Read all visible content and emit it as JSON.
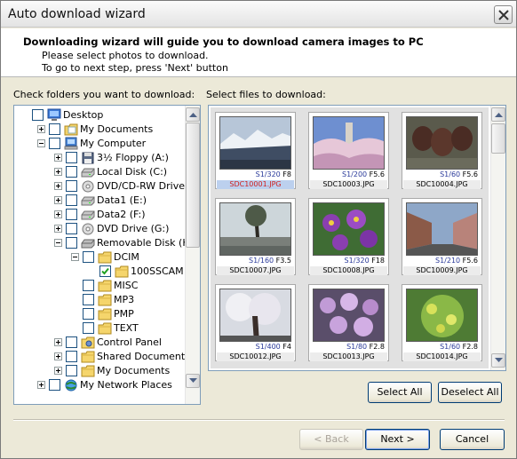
{
  "window": {
    "title": "Auto download wizard",
    "close_icon": "close-icon"
  },
  "header": {
    "title": "Downloading wizard will guide you to download camera images to PC",
    "line1": "Please select photos to download.",
    "line2": "To go to next step, press 'Next' button"
  },
  "folders": {
    "label": "Check folders you want to download:",
    "items": [
      {
        "label": "Desktop",
        "icon": "desktop-icon",
        "expander": "none",
        "checked": false
      },
      {
        "label": "My Documents",
        "icon": "folder-docs-icon",
        "expander": "plus",
        "checked": false
      },
      {
        "label": "My Computer",
        "icon": "computer-icon",
        "expander": "minus",
        "checked": false
      },
      {
        "label": "3½ Floppy (A:)",
        "icon": "floppy-icon",
        "expander": "plus",
        "checked": false
      },
      {
        "label": "Local Disk (C:)",
        "icon": "hard-disk-icon",
        "expander": "plus",
        "checked": false
      },
      {
        "label": "DVD/CD-RW Drive (D:)",
        "icon": "cd-drive-icon",
        "expander": "plus",
        "checked": false
      },
      {
        "label": "Data1 (E:)",
        "icon": "hard-disk-icon",
        "expander": "plus",
        "checked": false
      },
      {
        "label": "Data2 (F:)",
        "icon": "hard-disk-icon",
        "expander": "plus",
        "checked": false
      },
      {
        "label": "DVD Drive (G:)",
        "icon": "cd-drive-icon",
        "expander": "plus",
        "checked": false
      },
      {
        "label": "Removable Disk (K:)",
        "icon": "removable-disk-icon",
        "expander": "minus",
        "checked": false
      },
      {
        "label": "DCIM",
        "icon": "folder-icon",
        "expander": "minus",
        "checked": false
      },
      {
        "label": "100SSCAM",
        "icon": "folder-icon",
        "expander": "none",
        "checked": true
      },
      {
        "label": "MISC",
        "icon": "folder-icon",
        "expander": "none",
        "checked": false
      },
      {
        "label": "MP3",
        "icon": "folder-icon",
        "expander": "none",
        "checked": false
      },
      {
        "label": "PMP",
        "icon": "folder-icon",
        "expander": "none",
        "checked": false
      },
      {
        "label": "TEXT",
        "icon": "folder-icon",
        "expander": "none",
        "checked": false
      },
      {
        "label": "Control Panel",
        "icon": "control-panel-icon",
        "expander": "plus",
        "checked": false
      },
      {
        "label": "Shared Documents",
        "icon": "folder-icon",
        "expander": "plus",
        "checked": false
      },
      {
        "label": "My Documents",
        "icon": "folder-icon",
        "expander": "plus",
        "checked": false
      },
      {
        "label": "My Network Places",
        "icon": "network-icon",
        "expander": "plus",
        "checked": false
      }
    ]
  },
  "files": {
    "label": "Select files to download:",
    "thumbnails": [
      {
        "name": "SDC10001.JPG",
        "shutter": "S1/320",
        "aperture": "F8",
        "selected": true,
        "scene": "snowy-mountain-lake"
      },
      {
        "name": "SDC10003.JPG",
        "shutter": "S1/200",
        "aperture": "F5.6",
        "selected": false,
        "scene": "cherry-blossom-tower"
      },
      {
        "name": "SDC10004.JPG",
        "shutter": "S1/60",
        "aperture": "F5.6",
        "selected": false,
        "scene": "clay-pots"
      },
      {
        "name": "SDC10007.JPG",
        "shutter": "S1/160",
        "aperture": "F3.5",
        "selected": false,
        "scene": "tree-in-water"
      },
      {
        "name": "SDC10008.JPG",
        "shutter": "S1/320",
        "aperture": "F18",
        "selected": false,
        "scene": "purple-flowers"
      },
      {
        "name": "SDC10009.JPG",
        "shutter": "S1/210",
        "aperture": "F5.6",
        "selected": false,
        "scene": "city-street"
      },
      {
        "name": "SDC10012.JPG",
        "shutter": "S1/400",
        "aperture": "F4",
        "selected": false,
        "scene": "blossom-tree"
      },
      {
        "name": "SDC10013.JPG",
        "shutter": "S1/80",
        "aperture": "F2.8",
        "selected": false,
        "scene": "flower-bush"
      },
      {
        "name": "SDC10014.JPG",
        "shutter": "S1/60",
        "aperture": "F2.8",
        "selected": false,
        "scene": "green-shrub"
      }
    ]
  },
  "buttons": {
    "select_all": "Select All",
    "deselect_all": "Deselect All",
    "back": "< Back",
    "next": "Next >",
    "cancel": "Cancel"
  }
}
